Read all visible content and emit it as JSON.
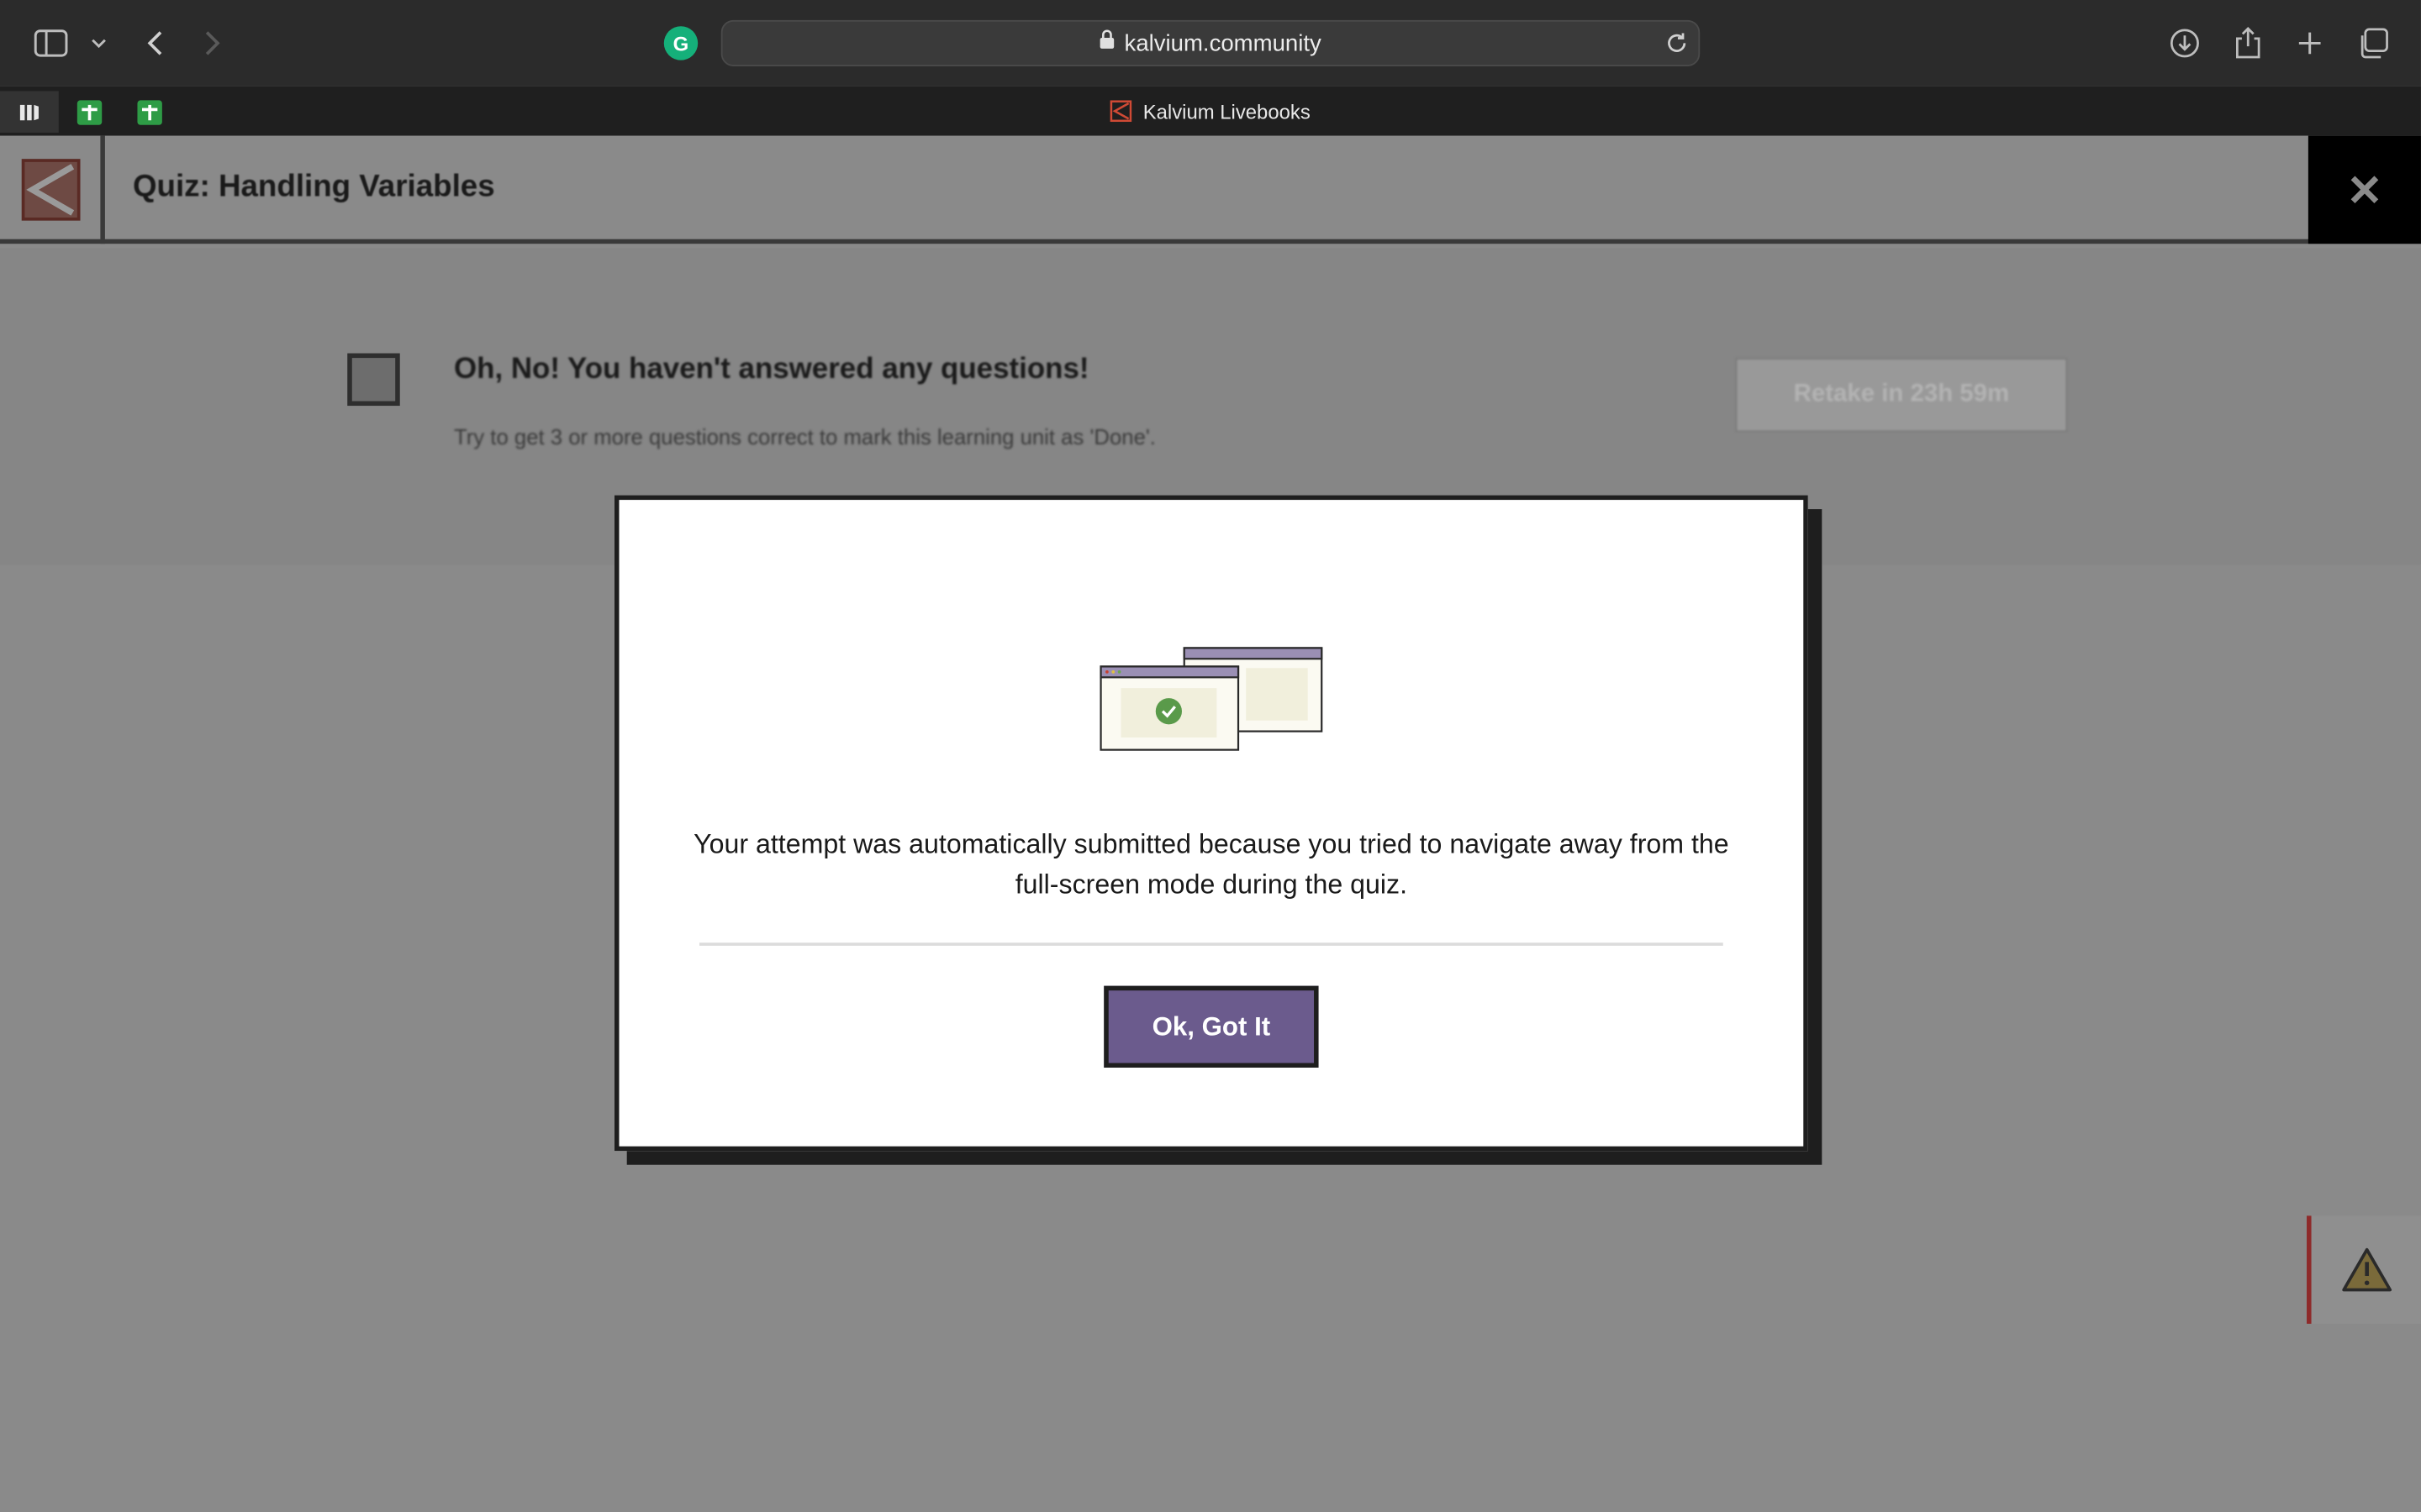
{
  "browser": {
    "url": "kalvium.community",
    "tab_title": "Kalvium Livebooks",
    "extension_letter": "G"
  },
  "page": {
    "title": "Quiz: Handling Variables",
    "close_glyph": "✕"
  },
  "result": {
    "headline": "Oh, No! You haven't answered any questions!",
    "subtext": "Try to get 3 or more questions correct to mark this learning unit as 'Done'.",
    "retake_label": "Retake in 23h 59m"
  },
  "modal": {
    "message": "Your attempt was automatically submitted because you tried to navigate away from the full-screen mode during the quiz.",
    "button_label": "Ok, Got It"
  },
  "colors": {
    "accent": "#6b5b8d",
    "success": "#4a9a4a",
    "brand_red": "#c8402e",
    "overlay": "#8a8a8a"
  },
  "icons": [
    "sidebar-icon",
    "chevron-down-icon",
    "back-icon",
    "forward-icon",
    "lock-icon",
    "reload-icon",
    "download-icon",
    "share-icon",
    "new-tab-icon",
    "tabs-overview-icon",
    "warning-icon",
    "check-icon"
  ]
}
